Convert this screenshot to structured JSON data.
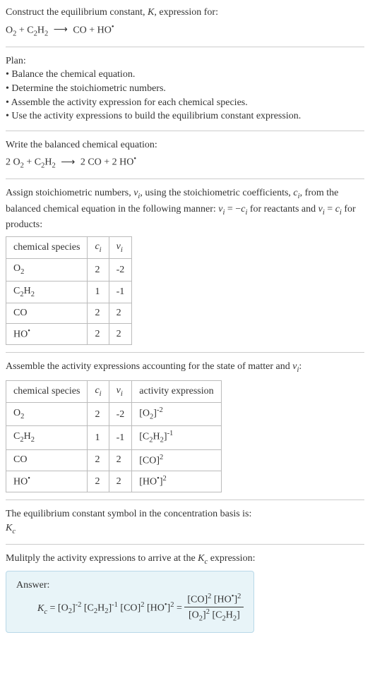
{
  "header": {
    "title": "Construct the equilibrium constant, K, expression for:",
    "equation": "O₂ + C₂H₂ ⟶ CO + HO•"
  },
  "plan": {
    "heading": "Plan:",
    "items": [
      "Balance the chemical equation.",
      "Determine the stoichiometric numbers.",
      "Assemble the activity expression for each chemical species.",
      "Use the activity expressions to build the equilibrium constant expression."
    ]
  },
  "balanced": {
    "heading": "Write the balanced chemical equation:",
    "equation": "2 O₂ + C₂H₂ ⟶ 2 CO + 2 HO•"
  },
  "stoich": {
    "intro_a": "Assign stoichiometric numbers, ",
    "intro_b": ", using the stoichiometric coefficients, ",
    "intro_c": ", from the balanced chemical equation in the following manner: ",
    "intro_d": " for reactants and ",
    "intro_e": " for products:",
    "table": {
      "headers": [
        "chemical species",
        "cᵢ",
        "νᵢ"
      ],
      "rows": [
        [
          "O₂",
          "2",
          "-2"
        ],
        [
          "C₂H₂",
          "1",
          "-1"
        ],
        [
          "CO",
          "2",
          "2"
        ],
        [
          "HO•",
          "2",
          "2"
        ]
      ]
    }
  },
  "activity": {
    "intro": "Assemble the activity expressions accounting for the state of matter and νᵢ:",
    "table": {
      "headers": [
        "chemical species",
        "cᵢ",
        "νᵢ",
        "activity expression"
      ],
      "rows": [
        {
          "species": "O₂",
          "c": "2",
          "v": "-2",
          "expr_base": "[O₂]",
          "expr_exp": "-2"
        },
        {
          "species": "C₂H₂",
          "c": "1",
          "v": "-1",
          "expr_base": "[C₂H₂]",
          "expr_exp": "-1"
        },
        {
          "species": "CO",
          "c": "2",
          "v": "2",
          "expr_base": "[CO]",
          "expr_exp": "2"
        },
        {
          "species": "HO•",
          "c": "2",
          "v": "2",
          "expr_base": "[HO•]",
          "expr_exp": "2"
        }
      ]
    }
  },
  "kc_symbol": {
    "intro": "The equilibrium constant symbol in the concentration basis is:",
    "symbol": "K",
    "symbol_sub": "c"
  },
  "multiply": {
    "intro_a": "Mulitply the activity expressions to arrive at the ",
    "intro_b": " expression:"
  },
  "answer": {
    "label": "Answer:",
    "lhs_k": "K",
    "lhs_k_sub": "c",
    "eq": " = ",
    "term1_base": "[O₂]",
    "term1_exp": "-2",
    "term2_base": "[C₂H₂]",
    "term2_exp": "-1",
    "term3_base": "[CO]",
    "term3_exp": "2",
    "term4_base": "[HO•]",
    "term4_exp": "2",
    "frac_num_a_base": "[CO]",
    "frac_num_a_exp": "2",
    "frac_num_b_base": "[HO•]",
    "frac_num_b_exp": "2",
    "frac_den_a_base": "[O₂]",
    "frac_den_a_exp": "2",
    "frac_den_b_base": "[C₂H₂]",
    "frac_den_b_exp": ""
  }
}
